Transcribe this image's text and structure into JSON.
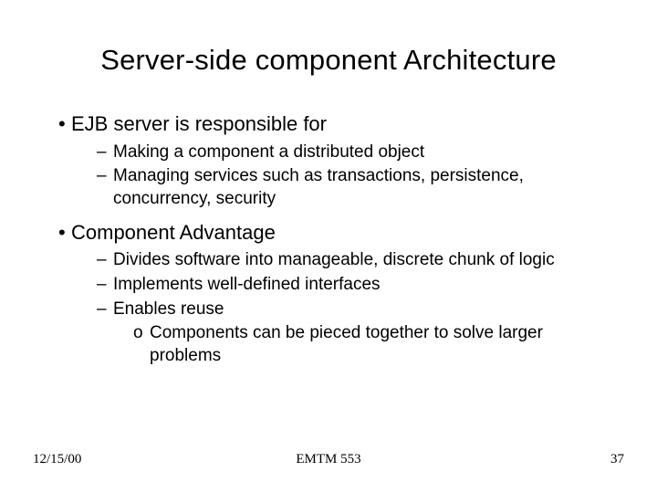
{
  "title": "Server-side component Architecture",
  "sections": [
    {
      "heading": "EJB server is responsible for",
      "items": [
        {
          "text": "Making a component a distributed object"
        },
        {
          "text": "Managing services such as transactions, persistence, concurrency, security"
        }
      ]
    },
    {
      "heading": "Component Advantage",
      "items": [
        {
          "text": "Divides software into manageable, discrete chunk of logic"
        },
        {
          "text": "Implements well-defined interfaces"
        },
        {
          "text": "Enables reuse",
          "subitems": [
            {
              "text": "Components can be pieced together to solve larger problems"
            }
          ]
        }
      ]
    }
  ],
  "footer": {
    "date": "12/15/00",
    "course": "EMTM 553",
    "page": "37"
  }
}
